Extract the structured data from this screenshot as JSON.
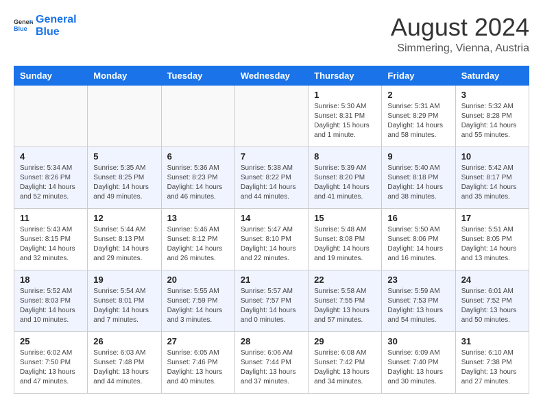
{
  "header": {
    "logo_line1": "General",
    "logo_line2": "Blue",
    "month_year": "August 2024",
    "location": "Simmering, Vienna, Austria"
  },
  "days_of_week": [
    "Sunday",
    "Monday",
    "Tuesday",
    "Wednesday",
    "Thursday",
    "Friday",
    "Saturday"
  ],
  "weeks": [
    [
      {
        "day": "",
        "info": ""
      },
      {
        "day": "",
        "info": ""
      },
      {
        "day": "",
        "info": ""
      },
      {
        "day": "",
        "info": ""
      },
      {
        "day": "1",
        "info": "Sunrise: 5:30 AM\nSunset: 8:31 PM\nDaylight: 15 hours\nand 1 minute."
      },
      {
        "day": "2",
        "info": "Sunrise: 5:31 AM\nSunset: 8:29 PM\nDaylight: 14 hours\nand 58 minutes."
      },
      {
        "day": "3",
        "info": "Sunrise: 5:32 AM\nSunset: 8:28 PM\nDaylight: 14 hours\nand 55 minutes."
      }
    ],
    [
      {
        "day": "4",
        "info": "Sunrise: 5:34 AM\nSunset: 8:26 PM\nDaylight: 14 hours\nand 52 minutes."
      },
      {
        "day": "5",
        "info": "Sunrise: 5:35 AM\nSunset: 8:25 PM\nDaylight: 14 hours\nand 49 minutes."
      },
      {
        "day": "6",
        "info": "Sunrise: 5:36 AM\nSunset: 8:23 PM\nDaylight: 14 hours\nand 46 minutes."
      },
      {
        "day": "7",
        "info": "Sunrise: 5:38 AM\nSunset: 8:22 PM\nDaylight: 14 hours\nand 44 minutes."
      },
      {
        "day": "8",
        "info": "Sunrise: 5:39 AM\nSunset: 8:20 PM\nDaylight: 14 hours\nand 41 minutes."
      },
      {
        "day": "9",
        "info": "Sunrise: 5:40 AM\nSunset: 8:18 PM\nDaylight: 14 hours\nand 38 minutes."
      },
      {
        "day": "10",
        "info": "Sunrise: 5:42 AM\nSunset: 8:17 PM\nDaylight: 14 hours\nand 35 minutes."
      }
    ],
    [
      {
        "day": "11",
        "info": "Sunrise: 5:43 AM\nSunset: 8:15 PM\nDaylight: 14 hours\nand 32 minutes."
      },
      {
        "day": "12",
        "info": "Sunrise: 5:44 AM\nSunset: 8:13 PM\nDaylight: 14 hours\nand 29 minutes."
      },
      {
        "day": "13",
        "info": "Sunrise: 5:46 AM\nSunset: 8:12 PM\nDaylight: 14 hours\nand 26 minutes."
      },
      {
        "day": "14",
        "info": "Sunrise: 5:47 AM\nSunset: 8:10 PM\nDaylight: 14 hours\nand 22 minutes."
      },
      {
        "day": "15",
        "info": "Sunrise: 5:48 AM\nSunset: 8:08 PM\nDaylight: 14 hours\nand 19 minutes."
      },
      {
        "day": "16",
        "info": "Sunrise: 5:50 AM\nSunset: 8:06 PM\nDaylight: 14 hours\nand 16 minutes."
      },
      {
        "day": "17",
        "info": "Sunrise: 5:51 AM\nSunset: 8:05 PM\nDaylight: 14 hours\nand 13 minutes."
      }
    ],
    [
      {
        "day": "18",
        "info": "Sunrise: 5:52 AM\nSunset: 8:03 PM\nDaylight: 14 hours\nand 10 minutes."
      },
      {
        "day": "19",
        "info": "Sunrise: 5:54 AM\nSunset: 8:01 PM\nDaylight: 14 hours\nand 7 minutes."
      },
      {
        "day": "20",
        "info": "Sunrise: 5:55 AM\nSunset: 7:59 PM\nDaylight: 14 hours\nand 3 minutes."
      },
      {
        "day": "21",
        "info": "Sunrise: 5:57 AM\nSunset: 7:57 PM\nDaylight: 14 hours\nand 0 minutes."
      },
      {
        "day": "22",
        "info": "Sunrise: 5:58 AM\nSunset: 7:55 PM\nDaylight: 13 hours\nand 57 minutes."
      },
      {
        "day": "23",
        "info": "Sunrise: 5:59 AM\nSunset: 7:53 PM\nDaylight: 13 hours\nand 54 minutes."
      },
      {
        "day": "24",
        "info": "Sunrise: 6:01 AM\nSunset: 7:52 PM\nDaylight: 13 hours\nand 50 minutes."
      }
    ],
    [
      {
        "day": "25",
        "info": "Sunrise: 6:02 AM\nSunset: 7:50 PM\nDaylight: 13 hours\nand 47 minutes."
      },
      {
        "day": "26",
        "info": "Sunrise: 6:03 AM\nSunset: 7:48 PM\nDaylight: 13 hours\nand 44 minutes."
      },
      {
        "day": "27",
        "info": "Sunrise: 6:05 AM\nSunset: 7:46 PM\nDaylight: 13 hours\nand 40 minutes."
      },
      {
        "day": "28",
        "info": "Sunrise: 6:06 AM\nSunset: 7:44 PM\nDaylight: 13 hours\nand 37 minutes."
      },
      {
        "day": "29",
        "info": "Sunrise: 6:08 AM\nSunset: 7:42 PM\nDaylight: 13 hours\nand 34 minutes."
      },
      {
        "day": "30",
        "info": "Sunrise: 6:09 AM\nSunset: 7:40 PM\nDaylight: 13 hours\nand 30 minutes."
      },
      {
        "day": "31",
        "info": "Sunrise: 6:10 AM\nSunset: 7:38 PM\nDaylight: 13 hours\nand 27 minutes."
      }
    ]
  ]
}
